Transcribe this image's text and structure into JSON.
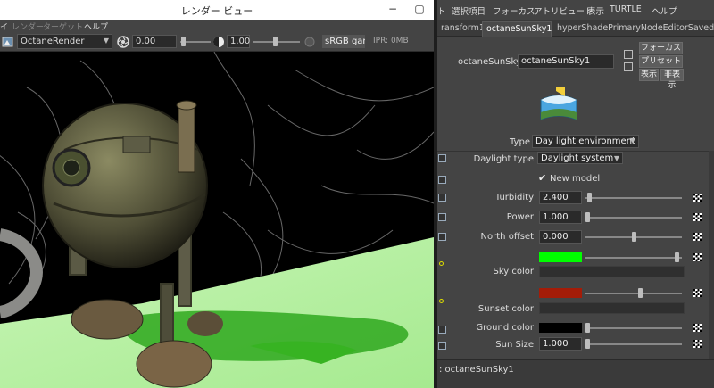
{
  "render_view": {
    "title": "レンダー ビュー",
    "window_controls": {
      "minimize": "−",
      "maximize": "▢"
    },
    "menu": [
      {
        "label": "イ",
        "dim": false
      },
      {
        "label": "レンダー",
        "dim": true
      },
      {
        "label": "ターゲット",
        "dim": true
      },
      {
        "label": "ヘルプ",
        "dim": false
      }
    ],
    "toolbar": {
      "renderer": "OctaneRender",
      "exposure": "0.00",
      "gamma": "1.00",
      "color_space": "sRGB gamma",
      "ipr": "IPR: 0MB"
    },
    "colors": {
      "ground": "#b7f0a5",
      "shadow": "#2fa81e",
      "robot": "#6b6a4a"
    }
  },
  "attribute_editor": {
    "menu": [
      "ト",
      "選択項目",
      "フォーカス",
      "アトリビュート",
      "表示",
      "TURTLE",
      "ヘルプ"
    ],
    "tabs": [
      {
        "label": "ransform1",
        "active": false
      },
      {
        "label": "octaneSunSky1",
        "active": true
      },
      {
        "label": "hyperShadePrimaryNodeEditorSavedTab",
        "active": false
      }
    ],
    "node": {
      "label": "octaneSunSky:",
      "value": "octaneSunSky1"
    },
    "buttons": {
      "focus": "フォーカス",
      "presets": "プリセット",
      "show": "表示",
      "hide": "非表示"
    },
    "type": {
      "label": "Type",
      "value": "Day light environment"
    },
    "attributes": {
      "daylight_type": {
        "label": "Daylight type",
        "value": "Daylight system"
      },
      "new_model": {
        "label": "New model",
        "checked": true
      },
      "turbidity": {
        "label": "Turbidity",
        "value": "2.400",
        "level": 0.02
      },
      "power": {
        "label": "Power",
        "value": "1.000",
        "level": 0.0
      },
      "north_offset": {
        "label": "North offset",
        "value": "0.000",
        "level": 0.5
      },
      "sky_color": {
        "label": "Sky color",
        "color": "#00ff00",
        "level": 0.97
      },
      "sunset_color": {
        "label": "Sunset color",
        "color": "#a41c08",
        "level": 0.57
      },
      "ground_color": {
        "label": "Ground color",
        "color": "#000000",
        "level": 0.0
      },
      "sun_size": {
        "label": "Sun Size",
        "value": "1.000",
        "level": 0.0
      }
    },
    "status": ": octaneSunSky1"
  }
}
